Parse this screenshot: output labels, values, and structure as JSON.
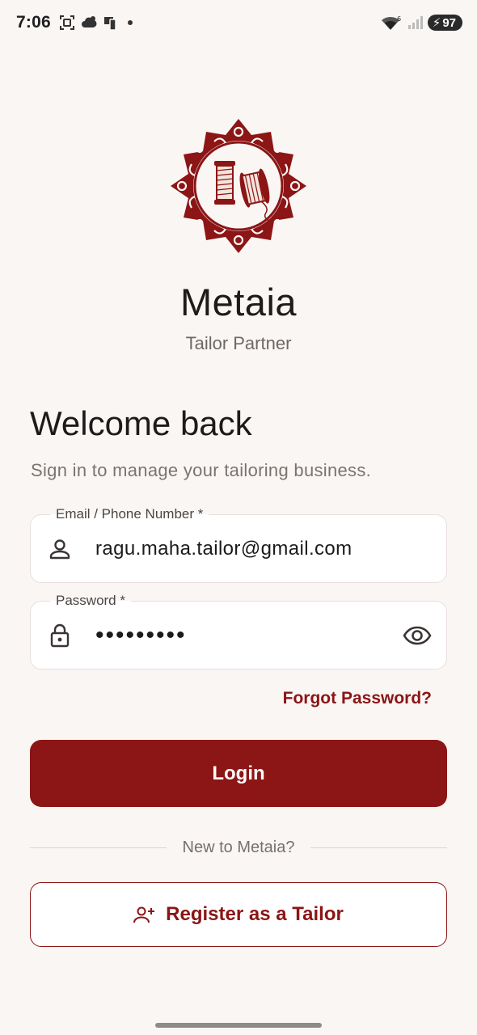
{
  "status_bar": {
    "time": "7:06",
    "battery": "97",
    "icons": [
      "screenshot-icon",
      "weather-icon",
      "device-icon",
      "wifi-icon",
      "signal-icon",
      "battery-icon"
    ]
  },
  "brand": {
    "name": "Metaia",
    "subtitle": "Tailor Partner",
    "logo_icon": "thread-spools-icon",
    "color": "#8c1515"
  },
  "welcome": {
    "title": "Welcome back",
    "subtitle": "Sign in to manage your tailoring business."
  },
  "form": {
    "email": {
      "label": "Email / Phone Number *",
      "value": "ragu.maha.tailor@gmail.com",
      "icon": "person-icon"
    },
    "password": {
      "label": "Password *",
      "value": "•••••••••",
      "icon": "lock-icon",
      "toggle_icon": "eye-icon"
    },
    "forgot_label": "Forgot Password?",
    "login_label": "Login"
  },
  "register": {
    "divider_text": "New to Metaia?",
    "button_label": "Register as a Tailor",
    "icon": "add-person-icon"
  }
}
